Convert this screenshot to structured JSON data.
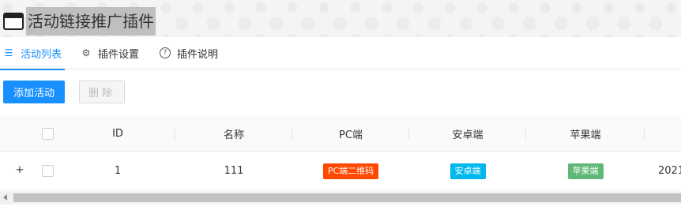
{
  "header": {
    "title": "活动链接推广插件",
    "icon": "window-icon"
  },
  "tabs": [
    {
      "label": "活动列表",
      "icon": "list-icon",
      "active": true
    },
    {
      "label": "插件设置",
      "icon": "gear-icon",
      "active": false
    },
    {
      "label": "插件说明",
      "icon": "question-circle-icon",
      "active": false
    }
  ],
  "toolbar": {
    "add_label": "添加活动",
    "delete_label": "删除"
  },
  "table": {
    "columns": [
      "",
      "ID",
      "名称",
      "PC端",
      "安卓端",
      "苹果端"
    ],
    "rows": [
      {
        "id": "1",
        "name": "111",
        "pc": "PC端二维码",
        "android": "安卓端",
        "apple": "苹果端",
        "date_partial": "2021"
      }
    ]
  },
  "colors": {
    "primary": "#1890ff",
    "pc_tag": "#ff4800",
    "android_tag": "#00b7ee",
    "apple_tag": "#5fb878"
  }
}
